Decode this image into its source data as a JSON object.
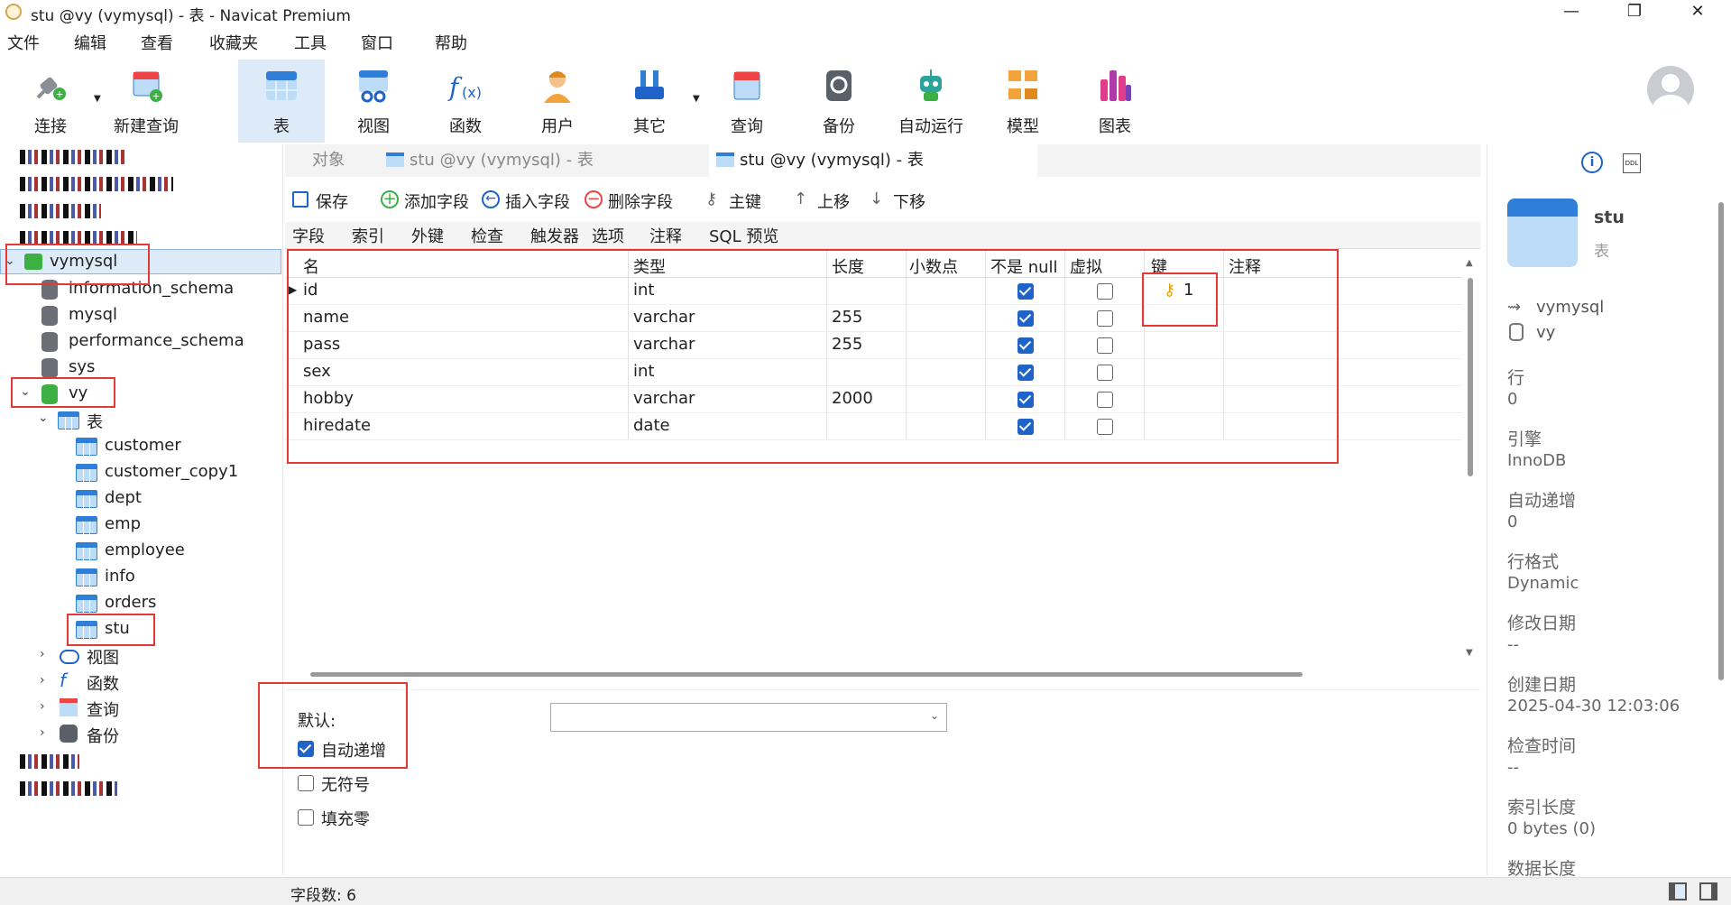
{
  "window": {
    "title": "stu @vy (vymysql) - 表 - Navicat Premium"
  },
  "menu": [
    "文件",
    "编辑",
    "查看",
    "收藏夹",
    "工具",
    "窗口",
    "帮助"
  ],
  "toolbar": {
    "items": [
      "连接",
      "新建查询",
      "表",
      "视图",
      "函数",
      "用户",
      "其它",
      "查询",
      "备份",
      "自动运行",
      "模型",
      "图表"
    ]
  },
  "tree": {
    "connection": "vymysql",
    "databases": [
      "information_schema",
      "mysql",
      "performance_schema",
      "sys",
      "vy"
    ],
    "tables_group": "表",
    "tables": [
      "customer",
      "customer_copy1",
      "dept",
      "emp",
      "employee",
      "info",
      "orders",
      "stu"
    ],
    "groups": [
      "视图",
      "函数",
      "查询",
      "备份"
    ]
  },
  "tabs": {
    "objects": "对象",
    "tab1": "stu @vy (vymysql) - 表",
    "tab2": "stu @vy (vymysql) - 表"
  },
  "editor": {
    "save": "保存",
    "add_field": "添加字段",
    "insert_field": "插入字段",
    "delete_field": "删除字段",
    "primary_key": "主键",
    "move_up": "上移",
    "move_down": "下移"
  },
  "subtabs": [
    "字段",
    "索引",
    "外键",
    "检查",
    "触发器",
    "选项",
    "注释",
    "SQL 预览"
  ],
  "grid": {
    "headers": [
      "名",
      "类型",
      "长度",
      "小数点",
      "不是 null",
      "虚拟",
      "键",
      "注释"
    ],
    "rows": [
      {
        "name": "id",
        "type": "int",
        "length": "",
        "notnull": true,
        "virtual": false,
        "key": "1"
      },
      {
        "name": "name",
        "type": "varchar",
        "length": "255",
        "notnull": true,
        "virtual": false,
        "key": ""
      },
      {
        "name": "pass",
        "type": "varchar",
        "length": "255",
        "notnull": true,
        "virtual": false,
        "key": ""
      },
      {
        "name": "sex",
        "type": "int",
        "length": "",
        "notnull": true,
        "virtual": false,
        "key": ""
      },
      {
        "name": "hobby",
        "type": "varchar",
        "length": "2000",
        "notnull": true,
        "virtual": false,
        "key": ""
      },
      {
        "name": "hiredate",
        "type": "date",
        "length": "",
        "notnull": true,
        "virtual": false,
        "key": ""
      }
    ]
  },
  "props": {
    "default_label": "默认:",
    "auto_increment": "自动递增",
    "unsigned": "无符号",
    "zerofill": "填充零",
    "auto_increment_checked": true,
    "unsigned_checked": false,
    "zerofill_checked": false
  },
  "info_panel": {
    "name": "stu",
    "kind": "表",
    "connection": "vymysql",
    "database": "vy",
    "fields": [
      {
        "k": "行",
        "v": "0"
      },
      {
        "k": "引擎",
        "v": "InnoDB"
      },
      {
        "k": "自动递增",
        "v": "0"
      },
      {
        "k": "行格式",
        "v": "Dynamic"
      },
      {
        "k": "修改日期",
        "v": "--"
      },
      {
        "k": "创建日期",
        "v": "2025-04-30 12:03:06"
      },
      {
        "k": "检查时间",
        "v": "--"
      },
      {
        "k": "索引长度",
        "v": "0 bytes (0)"
      },
      {
        "k": "数据长度",
        "v": ""
      }
    ]
  },
  "status": {
    "field_count": "字段数: 6"
  }
}
